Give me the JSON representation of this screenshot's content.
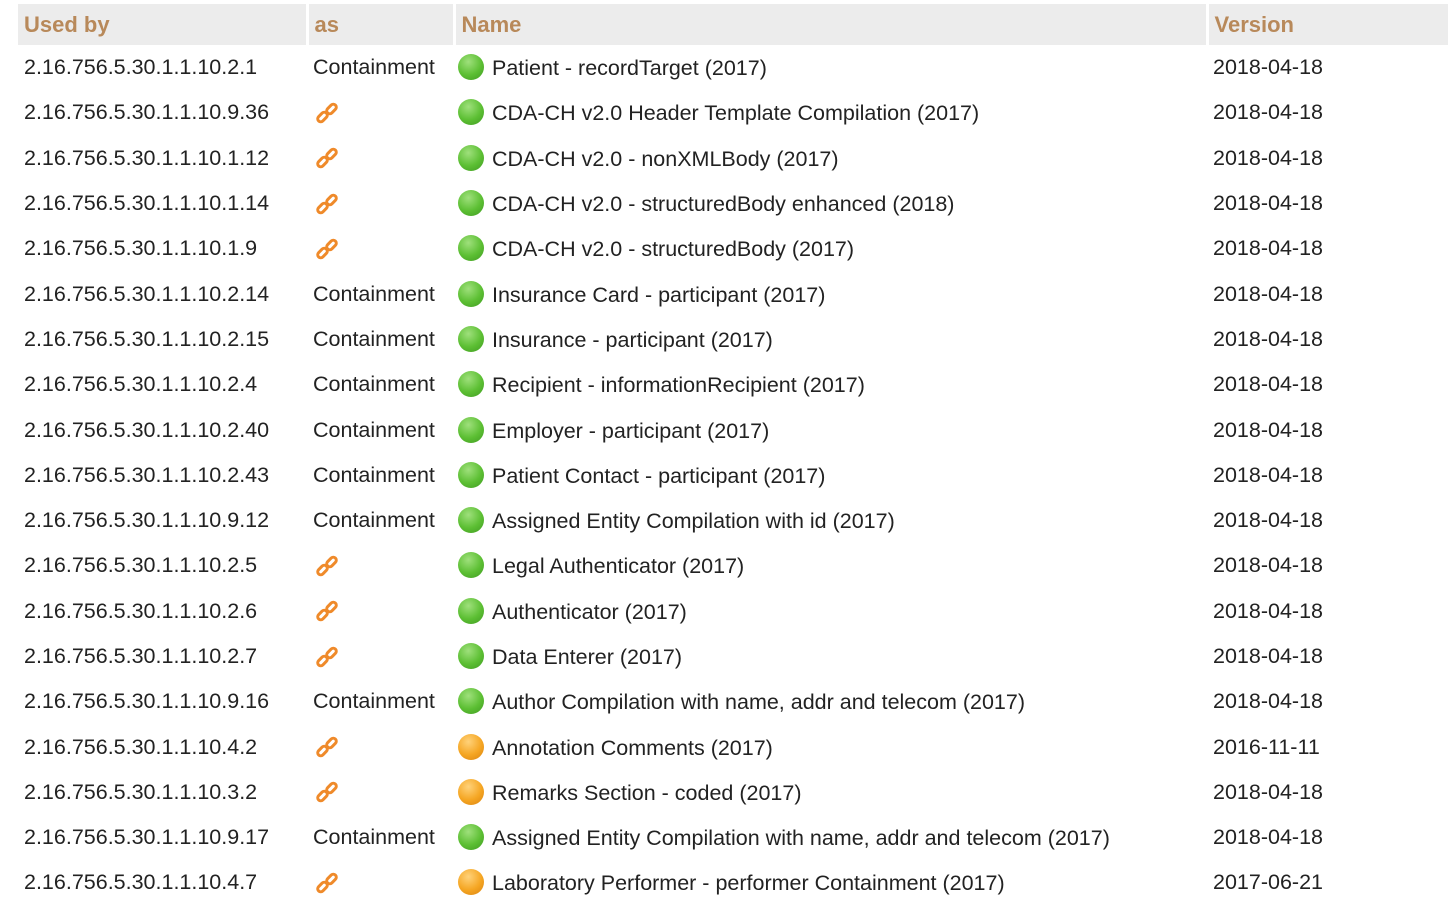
{
  "headers": {
    "used_by": "Used by",
    "as": "as",
    "name": "Name",
    "version": "Version"
  },
  "colors": {
    "header_text": "#b8895a",
    "header_bg": "#ececec",
    "status_active": "#5cbf33",
    "status_draft": "#f5a623",
    "link_icon": "#ef8a2a"
  },
  "rows": [
    {
      "used_by": "2.16.756.5.30.1.1.10.2.1",
      "as": "Containment",
      "as_icon": null,
      "status": "green",
      "name": "Patient - recordTarget (2017)",
      "version": "2018-04-18"
    },
    {
      "used_by": "2.16.756.5.30.1.1.10.9.36",
      "as": "",
      "as_icon": "link-icon",
      "status": "green",
      "name": "CDA-CH v2.0 Header Template Compilation (2017)",
      "version": "2018-04-18"
    },
    {
      "used_by": "2.16.756.5.30.1.1.10.1.12",
      "as": "",
      "as_icon": "link-icon",
      "status": "green",
      "name": "CDA-CH v2.0 - nonXMLBody (2017)",
      "version": "2018-04-18"
    },
    {
      "used_by": "2.16.756.5.30.1.1.10.1.14",
      "as": "",
      "as_icon": "link-icon",
      "status": "green",
      "name": "CDA-CH v2.0 - structuredBody enhanced (2018)",
      "version": "2018-04-18"
    },
    {
      "used_by": "2.16.756.5.30.1.1.10.1.9",
      "as": "",
      "as_icon": "link-icon",
      "status": "green",
      "name": "CDA-CH v2.0 - structuredBody (2017)",
      "version": "2018-04-18"
    },
    {
      "used_by": "2.16.756.5.30.1.1.10.2.14",
      "as": "Containment",
      "as_icon": null,
      "status": "green",
      "name": "Insurance Card - participant (2017)",
      "version": "2018-04-18"
    },
    {
      "used_by": "2.16.756.5.30.1.1.10.2.15",
      "as": "Containment",
      "as_icon": null,
      "status": "green",
      "name": "Insurance - participant (2017)",
      "version": "2018-04-18"
    },
    {
      "used_by": "2.16.756.5.30.1.1.10.2.4",
      "as": "Containment",
      "as_icon": null,
      "status": "green",
      "name": "Recipient - informationRecipient (2017)",
      "version": "2018-04-18"
    },
    {
      "used_by": "2.16.756.5.30.1.1.10.2.40",
      "as": "Containment",
      "as_icon": null,
      "status": "green",
      "name": "Employer - participant (2017)",
      "version": "2018-04-18"
    },
    {
      "used_by": "2.16.756.5.30.1.1.10.2.43",
      "as": "Containment",
      "as_icon": null,
      "status": "green",
      "name": "Patient Contact - participant (2017)",
      "version": "2018-04-18"
    },
    {
      "used_by": "2.16.756.5.30.1.1.10.9.12",
      "as": "Containment",
      "as_icon": null,
      "status": "green",
      "name": "Assigned Entity Compilation with id (2017)",
      "version": "2018-04-18"
    },
    {
      "used_by": "2.16.756.5.30.1.1.10.2.5",
      "as": "",
      "as_icon": "link-icon",
      "status": "green",
      "name": "Legal Authenticator (2017)",
      "version": "2018-04-18"
    },
    {
      "used_by": "2.16.756.5.30.1.1.10.2.6",
      "as": "",
      "as_icon": "link-icon",
      "status": "green",
      "name": "Authenticator (2017)",
      "version": "2018-04-18"
    },
    {
      "used_by": "2.16.756.5.30.1.1.10.2.7",
      "as": "",
      "as_icon": "link-icon",
      "status": "green",
      "name": "Data Enterer (2017)",
      "version": "2018-04-18"
    },
    {
      "used_by": "2.16.756.5.30.1.1.10.9.16",
      "as": "Containment",
      "as_icon": null,
      "status": "green",
      "name": "Author Compilation with name, addr and telecom (2017)",
      "version": "2018-04-18"
    },
    {
      "used_by": "2.16.756.5.30.1.1.10.4.2",
      "as": "",
      "as_icon": "link-icon",
      "status": "orange",
      "name": "Annotation Comments (2017)",
      "version": "2016-11-11"
    },
    {
      "used_by": "2.16.756.5.30.1.1.10.3.2",
      "as": "",
      "as_icon": "link-icon",
      "status": "orange",
      "name": "Remarks Section - coded (2017)",
      "version": "2018-04-18"
    },
    {
      "used_by": "2.16.756.5.30.1.1.10.9.17",
      "as": "Containment",
      "as_icon": null,
      "status": "green",
      "name": "Assigned Entity Compilation with name, addr and telecom (2017)",
      "version": "2018-04-18"
    },
    {
      "used_by": "2.16.756.5.30.1.1.10.4.7",
      "as": "",
      "as_icon": "link-icon",
      "status": "orange",
      "name": "Laboratory Performer - performer Containment (2017)",
      "version": "2017-06-21"
    }
  ]
}
